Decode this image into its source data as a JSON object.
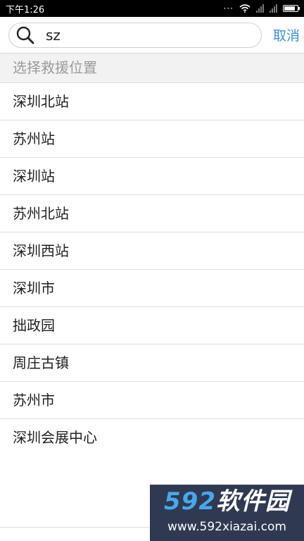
{
  "status_bar": {
    "time": "下午1:26",
    "dots": "···",
    "battery_level": 0.85
  },
  "search": {
    "value": "sz",
    "cancel_label": "取消"
  },
  "section_header": "选择救援位置",
  "results": [
    "深圳北站",
    "苏州站",
    "深圳站",
    "苏州北站",
    "深圳西站",
    "深圳市",
    "拙政园",
    "周庄古镇",
    "苏州市",
    "深圳会展中心"
  ],
  "watermark": {
    "logo_num": "592",
    "logo_text": "软件园",
    "url": "www.592xiazai.com"
  },
  "colors": {
    "accent": "#3b8fd6",
    "header_bg": "#f2f2f2",
    "status_bar": "#000000"
  },
  "icons": [
    "search-icon",
    "wifi-icon",
    "signal-icon",
    "battery-icon"
  ]
}
